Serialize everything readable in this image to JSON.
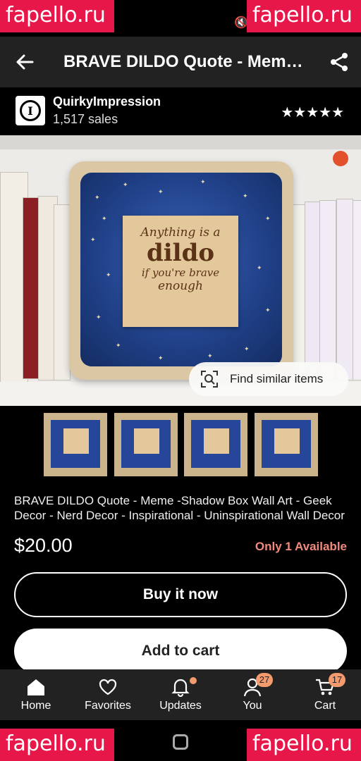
{
  "watermarks": [
    "fapello.ru",
    "fapello.ru",
    "fapello.ru",
    "fapello.ru"
  ],
  "appbar": {
    "title": "BRAVE DILDO Quote - Meme -Shadow Box Wall Art"
  },
  "shop": {
    "name": "QuirkyImpression",
    "sales": "1,517 sales",
    "rating": 5
  },
  "hero": {
    "plaque_lines": [
      "Anything is a",
      "dildo",
      "if you're brave",
      "enough"
    ],
    "find_similar_label": "Find similar items"
  },
  "listing": {
    "description": "BRAVE DILDO Quote - Meme -Shadow Box Wall Art - Geek Decor - Nerd Decor - Inspirational - Uninspirational Wall Decor",
    "price": "$20.00",
    "availability": "Only 1 Available"
  },
  "actions": {
    "buy_label": "Buy it now",
    "cart_label": "Add to cart"
  },
  "nav": {
    "items": [
      {
        "label": "Home",
        "icon": "home-icon"
      },
      {
        "label": "Favorites",
        "icon": "heart-icon"
      },
      {
        "label": "Updates",
        "icon": "bell-icon"
      },
      {
        "label": "You",
        "icon": "person-icon",
        "badge": "27"
      },
      {
        "label": "Cart",
        "icon": "cart-icon",
        "badge": "17"
      }
    ]
  },
  "colors": {
    "accent_badge": "#f39b6e",
    "availability": "#f08a7c",
    "watermark": "#e8174a"
  }
}
